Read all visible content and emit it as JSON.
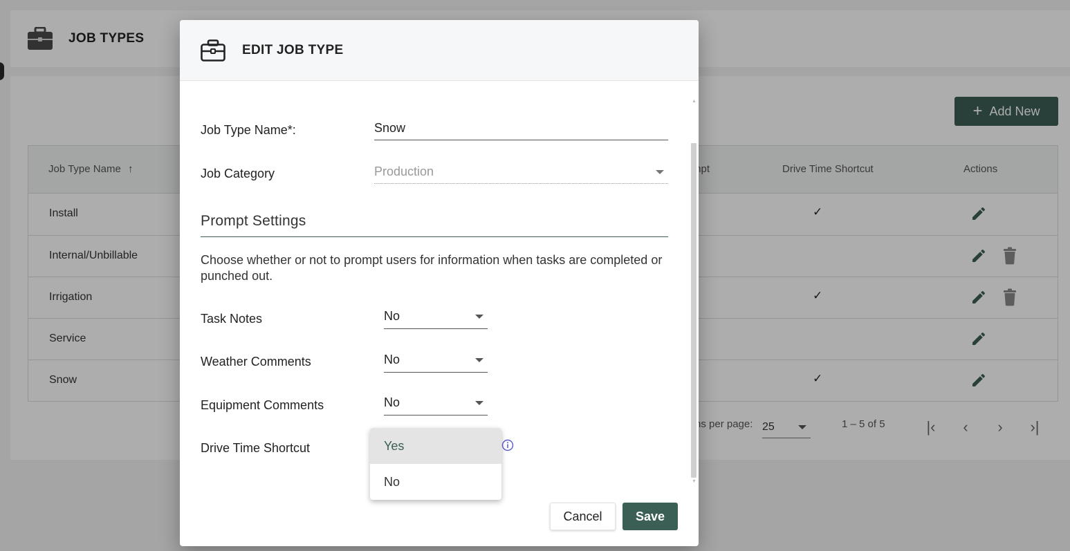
{
  "page": {
    "title": "JOB TYPES",
    "add_new_label": "Add New",
    "table": {
      "columns": {
        "job_type_name": "Job Type Name",
        "prompt_partial": "mpt",
        "drive_time_shortcut": "Drive Time Shortcut",
        "actions": "Actions"
      },
      "rows": [
        {
          "name": "Install",
          "drive_time": true,
          "deletable": false
        },
        {
          "name": "Internal/Unbillable",
          "drive_time": false,
          "deletable": true
        },
        {
          "name": "Irrigation",
          "drive_time": true,
          "deletable": true
        },
        {
          "name": "Service",
          "drive_time": false,
          "deletable": false
        },
        {
          "name": "Snow",
          "drive_time": true,
          "deletable": false
        }
      ],
      "check_glyph": "✓"
    },
    "pager": {
      "items_per_page_label": "ns per page:",
      "items_per_page_value": "25",
      "range_label": "1 – 5 of 5"
    }
  },
  "dialog": {
    "title": "EDIT JOB TYPE",
    "fields": {
      "job_type_name_label": "Job Type Name*:",
      "job_type_name_value": "Snow",
      "job_category_label": "Job Category",
      "job_category_value": "Production"
    },
    "prompt_settings": {
      "title": "Prompt Settings",
      "description": "Choose whether or not to prompt users for information when tasks are completed or punched out.",
      "task_notes_label": "Task Notes",
      "task_notes_value": "No",
      "weather_comments_label": "Weather Comments",
      "weather_comments_value": "No",
      "equipment_comments_label": "Equipment Comments",
      "equipment_comments_value": "No",
      "drive_time_shortcut_label": "Drive Time Shortcut"
    },
    "dropdown_options": [
      "Yes",
      "No"
    ],
    "cancel_label": "Cancel",
    "save_label": "Save"
  },
  "colors": {
    "accent": "#3b5f55",
    "info_icon": "#5b5bd6"
  }
}
